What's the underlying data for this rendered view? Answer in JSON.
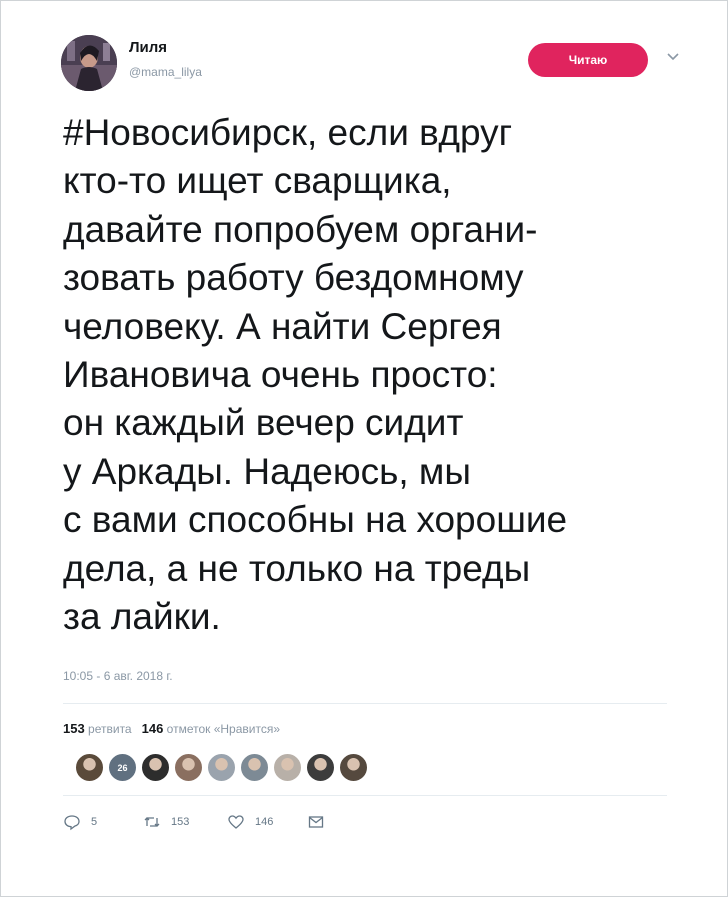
{
  "author": {
    "name": "Лиля",
    "handle": "@mama_lilya"
  },
  "follow_button": {
    "label": "Читаю"
  },
  "tweet": {
    "lines": [
      "#Новосибирск, если вдруг",
      "кто-то ищет сварщика,",
      "давайте попробуем органи-",
      "зовать работу бездомному",
      "человеку. А найти Сергея",
      "Ивановича очень просто:",
      "он каждый вечер сидит",
      "у Аркады. Надеюсь, мы",
      "с вами способны на хорошие",
      "дела, а не только на треды",
      "за лайки."
    ],
    "timestamp": "10:05 - 6 авг. 2018 г."
  },
  "stats": {
    "retweets_count": "153",
    "retweets_label": "ретвита",
    "likes_count": "146",
    "likes_label": "отметок «Нравится»"
  },
  "likers": [
    {
      "icon": "avatar-1",
      "color": "#5a4a3a"
    },
    {
      "icon": "avatar-2",
      "color": "#607080",
      "badge": "26"
    },
    {
      "icon": "avatar-3",
      "color": "#2d2d2d"
    },
    {
      "icon": "avatar-4",
      "color": "#8a6f60"
    },
    {
      "icon": "avatar-5",
      "color": "#9aa3ad"
    },
    {
      "icon": "avatar-6",
      "color": "#7d8a95"
    },
    {
      "icon": "avatar-7",
      "color": "#b8b0a8"
    },
    {
      "icon": "avatar-8",
      "color": "#3c3c3c"
    },
    {
      "icon": "avatar-9",
      "color": "#55493e"
    }
  ],
  "actions": {
    "reply_count": "5",
    "retweet_count": "153",
    "like_count": "146"
  },
  "colors": {
    "accent": "#e0245e",
    "muted": "#8b98a5",
    "text": "#14171a"
  }
}
